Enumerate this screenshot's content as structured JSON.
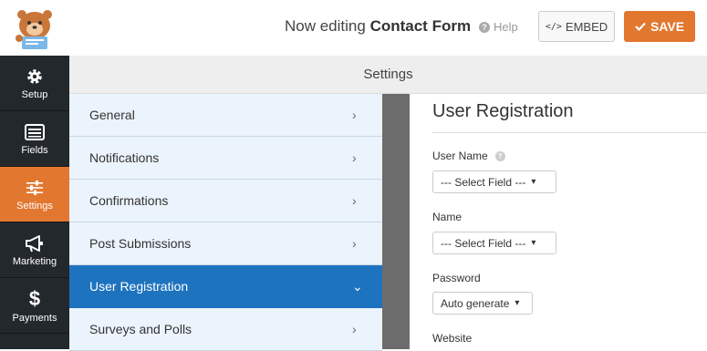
{
  "header": {
    "editing_prefix": "Now editing",
    "form_name": "Contact Form",
    "help_label": "Help",
    "embed_label": "EMBED",
    "embed_icon": "</>",
    "save_label": "SAVE"
  },
  "leftnav": {
    "items": [
      {
        "label": "Setup",
        "icon": "gear-icon"
      },
      {
        "label": "Fields",
        "icon": "list-icon"
      },
      {
        "label": "Settings",
        "icon": "sliders-icon",
        "active": true
      },
      {
        "label": "Marketing",
        "icon": "megaphone-icon"
      },
      {
        "label": "Payments",
        "icon": "dollar-icon"
      }
    ]
  },
  "settings": {
    "title": "Settings"
  },
  "panels": [
    {
      "label": "General"
    },
    {
      "label": "Notifications"
    },
    {
      "label": "Confirmations"
    },
    {
      "label": "Post Submissions"
    },
    {
      "label": "User Registration",
      "active": true
    },
    {
      "label": "Surveys and Polls"
    }
  ],
  "content": {
    "title": "User Registration",
    "fields": [
      {
        "label": "User Name",
        "value": "--- Select Field ---"
      },
      {
        "label": "Name",
        "value": "--- Select Field ---"
      },
      {
        "label": "Password",
        "value": "Auto generate"
      },
      {
        "label": "Website"
      }
    ]
  },
  "colors": {
    "accent": "#e27730",
    "active_panel": "#1e73be",
    "nav_bg": "#23282d"
  }
}
